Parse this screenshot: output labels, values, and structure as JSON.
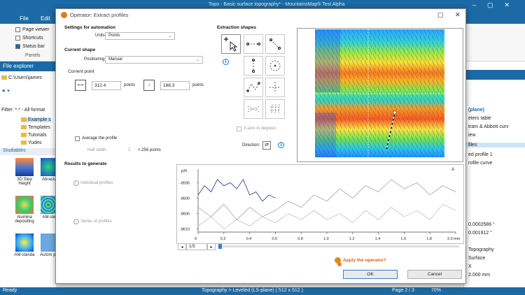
{
  "app": {
    "window_title": "Topo - Basic surface topography* - MountainsMap® Test Alpha",
    "menu_file": "File",
    "menu_edit": "Edit",
    "ribbon": {
      "page_viewer": "Page viewer",
      "shortcuts": "Shortcuts",
      "status_bar": "Status bar",
      "group_panels": "Panels"
    },
    "file_explorer": {
      "title": "File explorer",
      "path": "C:\\Users\\james",
      "filter": "Filter: *.* - All format",
      "items": [
        "Example s",
        "Templates",
        "Tutorials",
        "Yudes"
      ],
      "studiables_label": "Studiables",
      "thumbs": [
        "3D Step Height",
        "Abrasiv",
        "Alumina depositing",
        "AM-ste",
        "AM-standa",
        "Autom pa"
      ]
    },
    "right_panel": {
      "items": [
        "(plane)",
        "eters table",
        "tram & Abbott curv",
        "iew",
        "files",
        "ed profile 1",
        "rofile curve"
      ],
      "values": [
        "0.0002586 °",
        "0.001912 °",
        "Topography",
        "Surface",
        "X",
        "2.000 mm"
      ]
    },
    "status": {
      "ready": "Ready",
      "center": "Topography > Leveled (LS-plane) ( 512 x 512 )",
      "page": "Page 2 / 3",
      "zoom": "70%"
    }
  },
  "dialog": {
    "title": "Operator: Extract profiles",
    "settings_for_automation": "Settings for automation",
    "units_label": "Units:",
    "units_value": "Points",
    "current_shape": "Current shape",
    "positioning_label": "Positioning:",
    "positioning_value": "Manual",
    "current_point": "Current point",
    "x_value": "312.4",
    "x_unit": "points",
    "y_value": "188.3",
    "y_unit": "points",
    "average_profile": "Average the profile",
    "half_width_label": "Half width:",
    "half_width_value": "2",
    "half_width_unit": "< 256 points",
    "extraction_shapes": "Extraction shapes",
    "x_axis_degrees": "X-axis in degrees",
    "direction_label": "Direction:",
    "results_to_generate": "Results to generate",
    "individual_profiles": "Individual profiles",
    "series_of_profiles": "Series of profiles",
    "apply_operator": "Apply the operator?",
    "ok": "OK",
    "cancel": "Cancel",
    "nav_page": "1/3"
  },
  "chart_data": {
    "type": "line",
    "ylabel": "µm",
    "xlabel": "mm",
    "xlim": [
      0,
      2.0
    ],
    "ylim": [
      -8611,
      -8592
    ],
    "x_ticks": [
      "0",
      "0.2",
      "0.4",
      "0.6",
      "0.8",
      "1.0",
      "1.2",
      "1.4",
      "1.6",
      "1.8",
      "2.0 mm"
    ],
    "y_ticks": [
      "-8595",
      "-8600",
      "-8605",
      "-8610"
    ],
    "series": [
      {
        "color": "#2f4a8a",
        "x": [
          0,
          0.05,
          0.1,
          0.15,
          0.2,
          0.25,
          0.3,
          0.35,
          0.4,
          0.45,
          0.5,
          0.55,
          0.6
        ],
        "y": [
          -8599,
          -8596,
          -8598,
          -8594,
          -8596,
          -8595,
          -8597,
          -8594,
          -8599,
          -8598,
          -8601,
          -8599,
          -8600
        ]
      },
      {
        "color": "#9a9a9a",
        "x": [
          0,
          0.1,
          0.2,
          0.3,
          0.4,
          0.5,
          0.6,
          0.7,
          0.8,
          0.9,
          1.0,
          1.1,
          1.2,
          1.3,
          1.4,
          1.5,
          1.6,
          1.7,
          1.8,
          1.9,
          2.0
        ],
        "y": [
          -8603,
          -8606,
          -8602,
          -8607,
          -8603,
          -8606,
          -8604,
          -8601,
          -8603,
          -8599,
          -8601,
          -8597,
          -8600,
          -8596,
          -8598,
          -8594,
          -8597,
          -8595,
          -8599,
          -8596,
          -8598
        ]
      },
      {
        "color": "#b8b8b8",
        "x": [
          0,
          0.1,
          0.2,
          0.3,
          0.4,
          0.5,
          0.6,
          0.7,
          0.8,
          0.9,
          1.0,
          1.1,
          1.2,
          1.3,
          1.4,
          1.5,
          1.6,
          1.7,
          1.8,
          1.9,
          2.0
        ],
        "y": [
          -8609,
          -8606,
          -8610,
          -8607,
          -8609,
          -8606,
          -8608,
          -8605,
          -8607,
          -8604,
          -8607,
          -8605,
          -8608,
          -8604,
          -8607,
          -8603,
          -8606,
          -8604,
          -8607,
          -8602,
          -8604
        ]
      }
    ]
  }
}
